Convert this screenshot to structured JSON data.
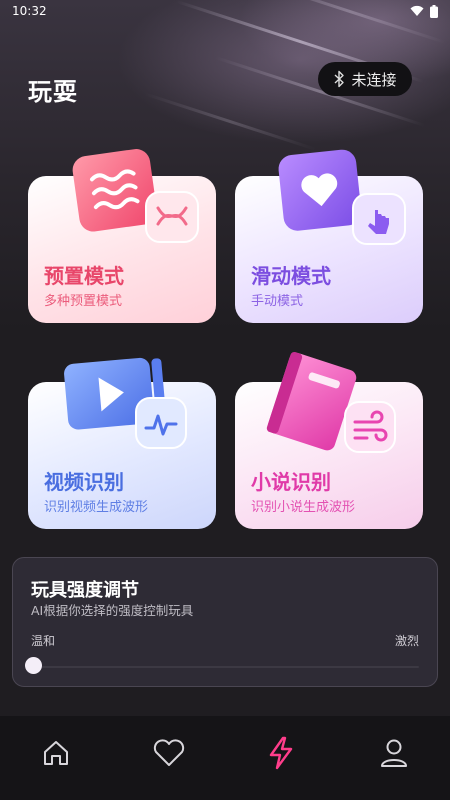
{
  "status": {
    "time": "10:32"
  },
  "header": {
    "title": "玩耍",
    "connect_label": "未连接"
  },
  "cards": [
    {
      "title": "预置模式",
      "subtitle": "多种预置模式"
    },
    {
      "title": "滑动模式",
      "subtitle": "手动模式"
    },
    {
      "title": "视频识别",
      "subtitle": "识别视频生成波形"
    },
    {
      "title": "小说识别",
      "subtitle": "识别小说生成波形"
    }
  ],
  "intensity": {
    "title": "玩具强度调节",
    "description": "AI根据你选择的强度控制玩具",
    "min_label": "温和",
    "max_label": "激烈",
    "value": 0
  },
  "tabs": [
    {
      "icon": "home-icon",
      "active": false
    },
    {
      "icon": "heart-icon",
      "active": false
    },
    {
      "icon": "lightning-icon",
      "active": true
    },
    {
      "icon": "profile-icon",
      "active": false
    }
  ],
  "colors": {
    "accent": "#ff3d8b",
    "preset": "#e8466a",
    "slide": "#7c4ee0",
    "video": "#4a6ee0",
    "novel": "#e03aa8"
  }
}
